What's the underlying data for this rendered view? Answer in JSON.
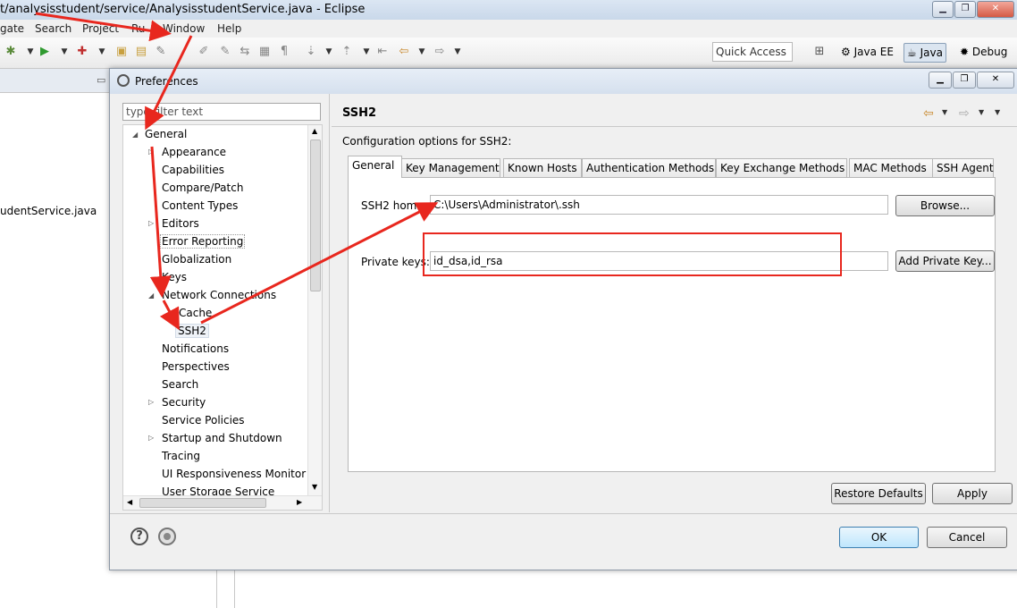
{
  "window": {
    "title": "t/analysisstudent/service/AnalysisstudentService.java - Eclipse",
    "menu": [
      "gate",
      "Search",
      "Project",
      "Ru",
      "Window",
      "Help"
    ],
    "quick_access": "Quick Access",
    "perspectives": [
      "Java EE",
      "Java",
      "Debug"
    ],
    "editor_file": "udentService.java"
  },
  "dialog": {
    "title": "Preferences",
    "filter_placeholder": "type filter text",
    "tree": [
      {
        "label": "General",
        "level": 0,
        "expanded": true
      },
      {
        "label": "Appearance",
        "level": 1,
        "expandable": true
      },
      {
        "label": "Capabilities",
        "level": 1
      },
      {
        "label": "Compare/Patch",
        "level": 1
      },
      {
        "label": "Content Types",
        "level": 1
      },
      {
        "label": "Editors",
        "level": 1,
        "expandable": true
      },
      {
        "label": "Error Reporting",
        "level": 1
      },
      {
        "label": "Globalization",
        "level": 1
      },
      {
        "label": "Keys",
        "level": 1
      },
      {
        "label": "Network Connections",
        "level": 1,
        "expanded": true
      },
      {
        "label": "Cache",
        "level": 2
      },
      {
        "label": "SSH2",
        "level": 2,
        "selected": true
      },
      {
        "label": "Notifications",
        "level": 1
      },
      {
        "label": "Perspectives",
        "level": 1
      },
      {
        "label": "Search",
        "level": 1
      },
      {
        "label": "Security",
        "level": 1,
        "expandable": true
      },
      {
        "label": "Service Policies",
        "level": 1
      },
      {
        "label": "Startup and Shutdown",
        "level": 1,
        "expandable": true
      },
      {
        "label": "Tracing",
        "level": 1
      },
      {
        "label": "UI Responsiveness Monitori",
        "level": 1
      },
      {
        "label": "User Storage Service",
        "level": 1
      }
    ],
    "page": {
      "title": "SSH2",
      "description": "Configuration options for SSH2:",
      "tabs": [
        "General",
        "Key Management",
        "Known Hosts",
        "Authentication Methods",
        "Key Exchange Methods",
        "MAC Methods",
        "SSH Agent"
      ],
      "active_tab": "General",
      "ssh2_home_label": "SSH2 home:",
      "ssh2_home_value": "C:\\Users\\Administrator\\.ssh",
      "browse_label": "Browse...",
      "private_keys_label": "Private keys:",
      "private_keys_value": "id_dsa,id_rsa",
      "add_key_label": "Add Private Key...",
      "restore_defaults": "Restore Defaults",
      "apply": "Apply"
    },
    "ok": "OK",
    "cancel": "Cancel",
    "icons": [
      "help-icon",
      "import-export-icon"
    ]
  },
  "annotation_color": "#e8271e"
}
